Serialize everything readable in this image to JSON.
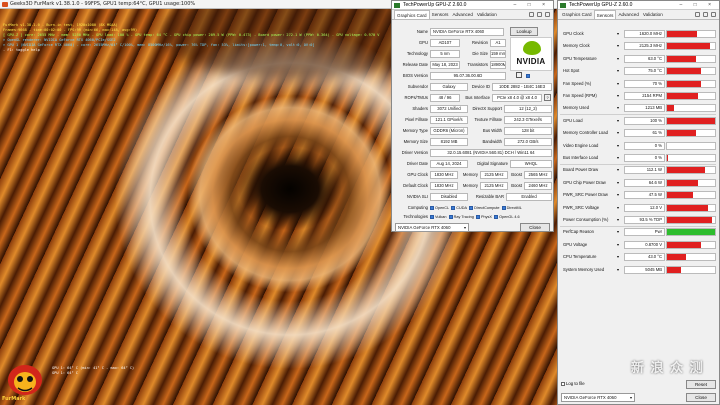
{
  "furmark": {
    "title": "Geeks3D FurMark v1.38.1.0 - 99FPS, GPU1 temp:64°C, GPU1 usage:100%",
    "window_controls": "–  □  ×",
    "hud": [
      "FurMark v1.38.1.0 - Burn-in test, 1920x1080 (8X MSAA)",
      "Frames:9668 - time:00:02:00 - FPS:99 (min:66, max:148, avg:99)",
      "[ GPU-Z ] core: 2655 MHz - mem: 5250 MHz - GPU load: 100 % - GPU temp: 64 °C - GPU chip power: 209.5 W (PPW: 0.473) - Board power: 272.1 W (PPW: 0.364) - GPU voltage: 0.970 V",
      "> OpenGL renderer: NVIDIA GeForce RTX 4060/PCIe/SSE2",
      "> GPU 1 (NVIDIA GeForce RTX 4060) - core: 2655MHz/64° C/100%, mem: 8500MHz/16%, power: 76% TDP, fan: 53%, limits:[power:1, temp:0, volt:0, OV:0]",
      "- F1: toggle help"
    ],
    "brand": "FurMark",
    "bottom": [
      "GPU 1: 64° C (min: 41° C - max: 64° C)",
      "GPU 1: 64° C"
    ]
  },
  "gpuz": {
    "title": "TechPowerUp GPU-Z 2.60.0",
    "controls": "–  □  ×",
    "tabs": [
      "Graphics Card",
      "Sensors",
      "Advanced",
      "Validation"
    ],
    "fields": {
      "name": {
        "label": "Name",
        "value": "NVIDIA GeForce RTX 4060"
      },
      "gpu": {
        "label": "GPU",
        "value": "AD107"
      },
      "revision": {
        "label": "Revision",
        "value": "A1"
      },
      "technology": {
        "label": "Technology",
        "value": "5 nm"
      },
      "die_size": {
        "label": "Die Size",
        "value": "159 mm²"
      },
      "release_date": {
        "label": "Release Date",
        "value": "May 18, 2023"
      },
      "transistors": {
        "label": "Transistors",
        "value": "18900M"
      },
      "bios": {
        "label": "BIOS Version",
        "value": "95.07.36.00.6D"
      },
      "uefi": "UEFI",
      "subvendor": {
        "label": "Subvendor",
        "value": "Galaxy"
      },
      "device_id": {
        "label": "Device ID",
        "value": "10DE 2882 - 1B4C 16E3"
      },
      "rops": {
        "label": "ROPs/TMUs",
        "value": "48 / 96"
      },
      "bus_interface": {
        "label": "Bus Interface",
        "value": "PCIe x8 4.0 @ x8 4.0"
      },
      "shaders": {
        "label": "Shaders",
        "value": "3072 Unified"
      },
      "directx": {
        "label": "DirectX Support",
        "value": "12 (12_2)"
      },
      "pixel_fill": {
        "label": "Pixel Fillrate",
        "value": "121.1 GPixel/s"
      },
      "texture_fill": {
        "label": "Texture Fillrate",
        "value": "242.3 GTexel/s"
      },
      "memory_type": {
        "label": "Memory Type",
        "value": "GDDR6 (Micron)"
      },
      "bus_width": {
        "label": "Bus Width",
        "value": "128 bit"
      },
      "memory_size": {
        "label": "Memory Size",
        "value": "8192 MB"
      },
      "bandwidth": {
        "label": "Bandwidth",
        "value": "272.0 GB/s"
      },
      "driver_version": {
        "label": "Driver Version",
        "value": "32.0.15.6081 (NVIDIA 560.81) DCH / Win11 64"
      },
      "driver_date": {
        "label": "Driver Date",
        "value": "Aug 14, 2024"
      },
      "digital_signature": {
        "label": "Digital Signature",
        "value": "WHQL"
      },
      "gpu_clock": {
        "label": "GPU Clock",
        "value": "1830 MHz"
      },
      "memory_clock": {
        "label": "Memory",
        "value": "2125 MHz"
      },
      "boost_clock": {
        "label": "Boost",
        "value": "2565 MHz"
      },
      "default_clock": {
        "label": "Default Clock",
        "value": "1830 MHz"
      },
      "default_memory": {
        "label": "Memory",
        "value": "2125 MHz"
      },
      "default_boost": {
        "label": "Boost",
        "value": "2460 MHz"
      },
      "sli": {
        "label": "NVIDIA SLI",
        "value": "Disabled"
      },
      "resizable_bar": {
        "label": "Resizable BAR",
        "value": "Enabled"
      },
      "computing": {
        "label": "Computing"
      },
      "technologies": {
        "label": "Technologies"
      }
    },
    "computing": [
      "OpenCL",
      "CUDA",
      "DirectCompute",
      "DirectML"
    ],
    "technologies": [
      "Vulkan",
      "Ray Tracing",
      "PhysX",
      "OpenGL 4.6"
    ],
    "lookup": "Lookup",
    "nvidia_logo": "NVIDIA",
    "selected_gpu": "NVIDIA GeForce RTX 4060",
    "close": "Close"
  },
  "sensors": {
    "title": "TechPowerUp GPU-Z 2.60.0",
    "controls": "–  □  ×",
    "tabs": [
      "Graphics Card",
      "Sensors",
      "Advanced",
      "Validation"
    ],
    "rows": [
      {
        "name": "GPU Clock",
        "value": "1620.0 MHz",
        "level": 0.62,
        "color": "#e02020"
      },
      {
        "name": "Memory Clock",
        "value": "2125.3 MHz",
        "level": 0.9,
        "color": "#e02020"
      },
      {
        "name": "GPU Temperature",
        "value": "63.0 °C",
        "level": 0.6,
        "color": "#e02020"
      },
      {
        "name": "Hot Spot",
        "value": "75.0 °C",
        "level": 0.7,
        "color": "#e02020"
      },
      {
        "name": "Fan Speed (%)",
        "value": "70 %",
        "level": 0.7,
        "color": "#e02020"
      },
      {
        "name": "Fan Speed (RPM)",
        "value": "2154 RPM",
        "level": 0.65,
        "color": "#e02020"
      },
      {
        "name": "Memory Used",
        "value": "1213 MB",
        "level": 0.15,
        "color": "#e02020"
      },
      {
        "name": "GPU Load",
        "value": "100 %",
        "level": 1.0,
        "color": "#e02020"
      },
      {
        "name": "Memory Controller Load",
        "value": "61 %",
        "level": 0.61,
        "color": "#e02020"
      },
      {
        "name": "Video Engine Load",
        "value": "0 %",
        "level": 0,
        "color": "#e02020"
      },
      {
        "name": "Bus Interface Load",
        "value": "0 %",
        "level": 0.03,
        "color": "#e02020"
      },
      {
        "name": "Board Power Draw",
        "value": "112.1 W",
        "level": 0.8,
        "color": "#e02020"
      },
      {
        "name": "GPU Chip Power Draw",
        "value": "64.6 W",
        "level": 0.65,
        "color": "#e02020"
      },
      {
        "name": "PWR_SRC Power Draw",
        "value": "47.5 W",
        "level": 0.55,
        "color": "#e02020"
      },
      {
        "name": "PWR_SRC Voltage",
        "value": "12.0 V",
        "level": 0.85,
        "color": "#e02020"
      },
      {
        "name": "Power Consumption (%)",
        "value": "93.5 % TDP",
        "level": 0.93,
        "color": "#e02020"
      },
      {
        "name": "PerfCap Reason",
        "value": "Pwr",
        "level": 1.0,
        "color": "#2ebd2e"
      },
      {
        "name": "GPU Voltage",
        "value": "0.8700 V",
        "level": 0.7,
        "color": "#e02020"
      },
      {
        "name": "CPU Temperature",
        "value": "43.0 °C",
        "level": 0.4,
        "color": "#e02020"
      },
      {
        "name": "System Memory Used",
        "value": "5045 MB",
        "level": 0.3,
        "color": "#e02020"
      }
    ],
    "log_to_file": "Log to file",
    "reset": "Reset",
    "selected_gpu": "NVIDIA GeForce RTX 4060",
    "close": "Close"
  },
  "watermark": "新 浪 众 测"
}
